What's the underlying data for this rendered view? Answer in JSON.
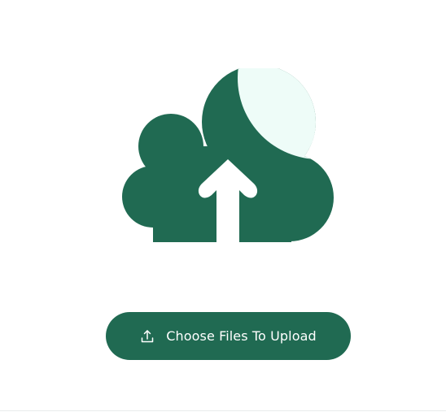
{
  "colors": {
    "accent": "#206a52",
    "accent_highlight": "#eefcf8",
    "background": "#ffffff"
  },
  "illustration": {
    "icon": "cloud-upload-icon"
  },
  "upload_button": {
    "label": "Choose Files To Upload",
    "icon": "upload-icon"
  }
}
